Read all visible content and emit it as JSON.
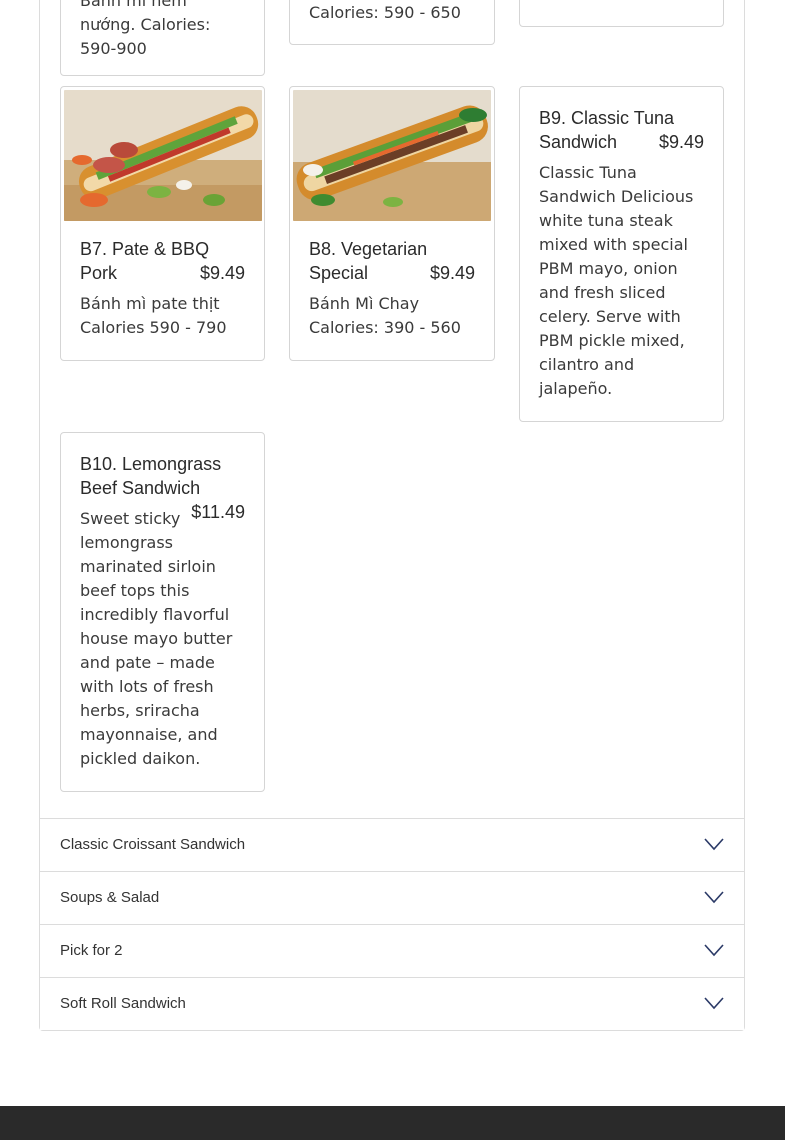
{
  "top_cards": [
    {
      "desc_partial": "Bánh mì nem nướng. Calories: 590-900"
    },
    {
      "desc_partial": "Calories: 590 - 650"
    },
    {
      "desc_partial": ""
    }
  ],
  "cards": [
    {
      "id": "b7",
      "title": "B7. Pate & BBQ Pork",
      "price": "$9.49",
      "desc": "Bánh mì pate thịt Calories 590 - 790",
      "photo_icon": "banh-mi-bbq-pork-photo"
    },
    {
      "id": "b8",
      "title": "B8. Vegetarian Special",
      "price": "$9.49",
      "desc": "Bánh Mì Chay Calories: 390 - 560",
      "photo_icon": "banh-mi-vegetarian-photo"
    },
    {
      "id": "b9",
      "title": "B9. Classic Tuna Sandwich",
      "price": "$9.49",
      "desc": "Classic Tuna Sandwich Delicious white tuna steak mixed with special PBM mayo, onion and fresh sliced celery. Serve with PBM pickle mixed, cilantro and jalapeño."
    },
    {
      "id": "b10",
      "title": "B10. Lemongrass Beef Sandwich",
      "price": "$11.49",
      "desc": "Sweet sticky lemongrass marinated sirloin beef tops this incredibly flavorful house mayo butter and pate – made with lots of fresh herbs, sriracha mayonnaise, and pickled daikon."
    }
  ],
  "accordion": [
    {
      "label": "Classic Croissant Sandwich",
      "icon": "chevron-down-icon"
    },
    {
      "label": "Soups & Salad",
      "icon": "chevron-down-icon"
    },
    {
      "label": "Pick for 2",
      "icon": "chevron-down-icon"
    },
    {
      "label": "Soft Roll Sandwich",
      "icon": "chevron-down-icon"
    }
  ],
  "colors": {
    "border": "#d5d5d5",
    "text": "#2b2b2b",
    "footer": "#2a2a2a"
  }
}
